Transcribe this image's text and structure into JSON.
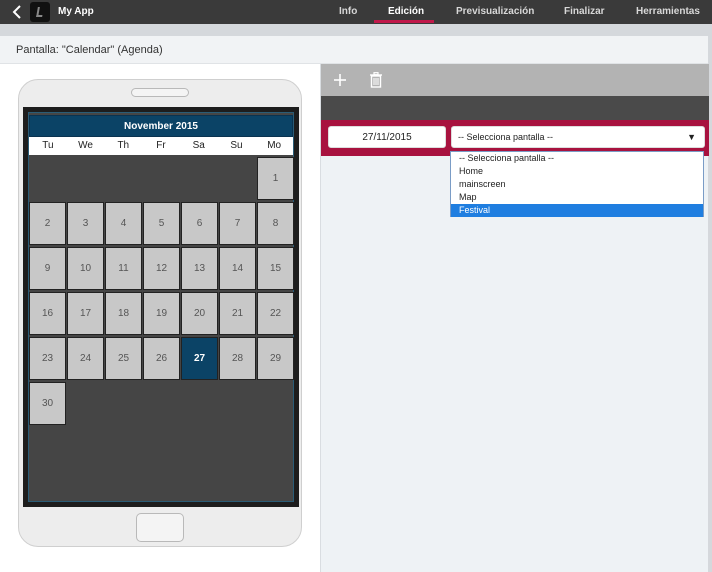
{
  "topbar": {
    "app_name": "My App",
    "tabs": [
      {
        "label": "Info"
      },
      {
        "label": "Edición"
      },
      {
        "label": "Previsualización"
      },
      {
        "label": "Finalizar"
      },
      {
        "label": "Herramientas"
      }
    ],
    "active_tab": "Edición"
  },
  "header": {
    "screen_title": "Pantalla: \"Calendar\" (Agenda)"
  },
  "calendar": {
    "month_label": "November 2015",
    "weekdays": [
      "Tu",
      "We",
      "Th",
      "Fr",
      "Sa",
      "Su",
      "Mo"
    ],
    "days": [
      "1",
      "2",
      "3",
      "4",
      "5",
      "6",
      "7",
      "8",
      "9",
      "10",
      "11",
      "12",
      "13",
      "14",
      "15",
      "16",
      "17",
      "18",
      "19",
      "20",
      "21",
      "22",
      "23",
      "24",
      "25",
      "26",
      "27",
      "28",
      "29",
      "30"
    ],
    "selected_day": "27"
  },
  "editor": {
    "date_value": "27/11/2015",
    "select_value": "-- Selecciona pantalla --",
    "dropdown_options": [
      "-- Selecciona pantalla --",
      "Home",
      "mainscreen",
      "Map",
      "Festival"
    ],
    "highlighted_option": "Festival"
  },
  "icons": {
    "back": "chevron-left-icon",
    "app": "app-logo-icon",
    "add": "plus-icon",
    "delete": "trash-icon",
    "dropdown": "triangle-down-icon"
  },
  "colors": {
    "topbar_bg": "#3a3a3a",
    "accent": "#c0184a",
    "row_band": "#a8123f",
    "calendar_header": "#0b4366",
    "dropdown_highlight": "#1f7ee0"
  }
}
